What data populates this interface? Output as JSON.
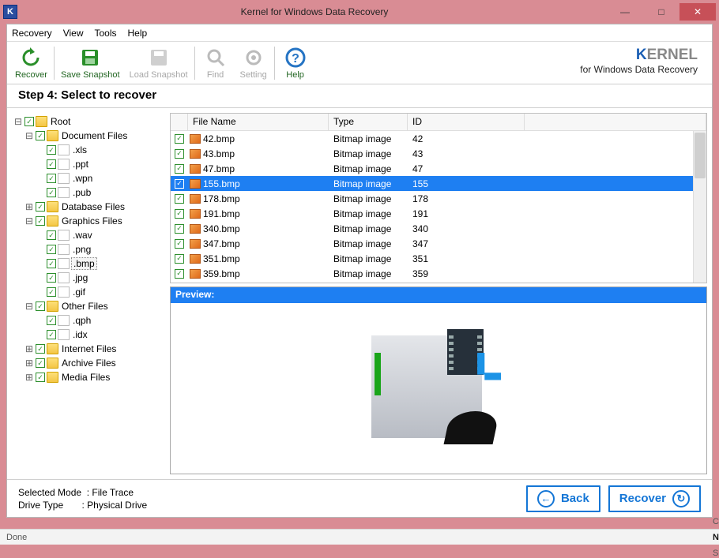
{
  "window": {
    "title": "Kernel for Windows Data Recovery"
  },
  "menu": {
    "recovery": "Recovery",
    "view": "View",
    "tools": "Tools",
    "help": "Help"
  },
  "toolbar": {
    "recover": "Recover",
    "save_snapshot": "Save Snapshot",
    "load_snapshot": "Load Snapshot",
    "find": "Find",
    "setting": "Setting",
    "help": "Help"
  },
  "brand": {
    "name_prefix": "K",
    "name_rest": "ERNEL",
    "tagline": "for Windows Data Recovery"
  },
  "step": {
    "label": "Step 4: Select to recover"
  },
  "tree": {
    "root": "Root",
    "document_files": "Document Files",
    "xls": ".xls",
    "ppt": ".ppt",
    "wpn": ".wpn",
    "pub": ".pub",
    "database_files": "Database Files",
    "graphics_files": "Graphics Files",
    "wav": ".wav",
    "png": ".png",
    "bmp": ".bmp",
    "jpg": ".jpg",
    "gif": ".gif",
    "other_files": "Other Files",
    "qph": ".qph",
    "idx": ".idx",
    "internet_files": "Internet Files",
    "archive_files": "Archive Files",
    "media_files": "Media Files"
  },
  "list": {
    "columns": {
      "filename": "File Name",
      "type": "Type",
      "id": "ID"
    },
    "rows": [
      {
        "name": "42.bmp",
        "type": "Bitmap image",
        "id": "42",
        "selected": false
      },
      {
        "name": "43.bmp",
        "type": "Bitmap image",
        "id": "43",
        "selected": false
      },
      {
        "name": "47.bmp",
        "type": "Bitmap image",
        "id": "47",
        "selected": false
      },
      {
        "name": "155.bmp",
        "type": "Bitmap image",
        "id": "155",
        "selected": true
      },
      {
        "name": "178.bmp",
        "type": "Bitmap image",
        "id": "178",
        "selected": false
      },
      {
        "name": "191.bmp",
        "type": "Bitmap image",
        "id": "191",
        "selected": false
      },
      {
        "name": "340.bmp",
        "type": "Bitmap image",
        "id": "340",
        "selected": false
      },
      {
        "name": "347.bmp",
        "type": "Bitmap image",
        "id": "347",
        "selected": false
      },
      {
        "name": "351.bmp",
        "type": "Bitmap image",
        "id": "351",
        "selected": false
      },
      {
        "name": "359.bmp",
        "type": "Bitmap image",
        "id": "359",
        "selected": false
      }
    ]
  },
  "preview": {
    "label": "Preview:"
  },
  "footer": {
    "mode_label": "Selected Mode",
    "mode_value": "File Trace",
    "drive_label": "Drive Type",
    "drive_value": "Physical Drive",
    "back": "Back",
    "recover": "Recover"
  },
  "status": {
    "done": "Done",
    "cap": "CAP",
    "num": "NUM",
    "scrl": "SCRL"
  }
}
